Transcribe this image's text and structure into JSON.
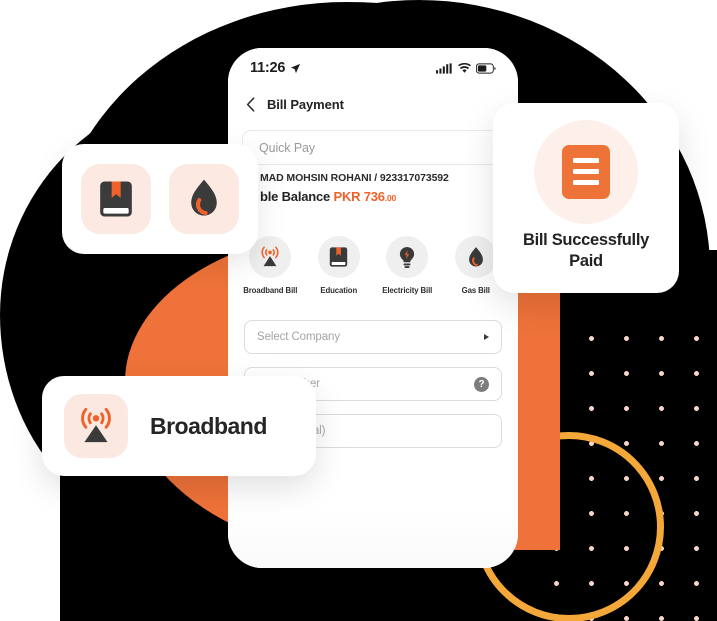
{
  "colors": {
    "brand_orange": "#EE7239",
    "accent_orange": "#F0622A",
    "amber_ring": "#F5A83A",
    "dot_pink": "#F6D5C8",
    "backdrop": "#000000",
    "tile_peach": "#FCEAE2"
  },
  "phone": {
    "statusbar": {
      "time": "11:26",
      "location_icon": "location-arrow-icon",
      "signal_icon": "cellular-signal-icon",
      "wifi_icon": "wifi-icon",
      "battery_icon": "battery-icon"
    },
    "nav": {
      "back_icon": "chevron-left-icon",
      "title": "Bill Payment"
    },
    "tabs": [
      {
        "label": "Quick Pay",
        "selected": true
      }
    ],
    "account": {
      "name_line": "MAD MOHSIN ROHANI / 923317073592",
      "balance_label": "ble Balance",
      "balance_currency_amount": "PKR 736",
      "balance_cents": ".00"
    },
    "categories": [
      {
        "label": "Broadband Bill",
        "icon": "broadband-antenna-icon"
      },
      {
        "label": "Education",
        "icon": "book-icon"
      },
      {
        "label": "Electricity Bill",
        "icon": "lightbulb-icon"
      },
      {
        "label": "Gas Bill",
        "icon": "gas-droplet-icon"
      }
    ],
    "fields": [
      {
        "name": "select-company",
        "placeholder": "Select Company",
        "trailing_icon": "caret-right-icon"
      },
      {
        "name": "consumer-number",
        "placeholder": "mer Number",
        "trailing_icon": "help-question-icon",
        "trailing_label": "?"
      },
      {
        "name": "nickname",
        "placeholder": "me (Optional)",
        "trailing_icon": "none"
      }
    ]
  },
  "cards": {
    "icon_pair": {
      "icons": [
        {
          "name": "book-icon"
        },
        {
          "name": "gas-droplet-icon"
        }
      ]
    },
    "bill_paid": {
      "icon": "bill-document-icon",
      "title": "Bill Successfully Paid"
    },
    "broadband": {
      "icon": "broadband-antenna-icon",
      "title": "Broadband"
    }
  }
}
